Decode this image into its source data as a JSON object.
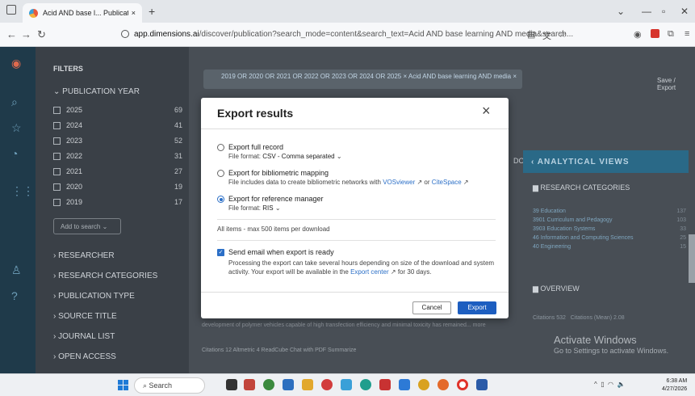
{
  "browser": {
    "tab_title": "Acid AND base l... Publication Y",
    "tab_close": "×",
    "new_tab": "+",
    "url_domain": "app.dimensions.ai",
    "url_path": "/discover/publication?search_mode=content&search_text=Acid AND base learning AND media&search..."
  },
  "filters": {
    "heading": "FILTERS",
    "pub_year_label": "PUBLICATION YEAR",
    "years": [
      {
        "year": "2025",
        "count": "69"
      },
      {
        "year": "2024",
        "count": "41"
      },
      {
        "year": "2023",
        "count": "52"
      },
      {
        "year": "2022",
        "count": "31"
      },
      {
        "year": "2021",
        "count": "27"
      },
      {
        "year": "2020",
        "count": "19"
      },
      {
        "year": "2019",
        "count": "17"
      }
    ],
    "add_to_search": "Add to search",
    "sections": [
      "RESEARCHER",
      "RESEARCH CATEGORIES",
      "PUBLICATION TYPE",
      "SOURCE TITLE",
      "JOURNAL LIST",
      "OPEN ACCESS"
    ]
  },
  "main": {
    "chips": "2019 OR 2020 OR 2021 OR 2022 OR 2023 OR 2024 OR 2025 ×   Acid AND base learning AND media ×",
    "save_export": "Save / Export",
    "documents": "DOCUMENTS",
    "analytical_views": "ANALYTICAL VIEWS",
    "research_categories": "RESEARCH CATEGORIES",
    "categories": [
      {
        "name": "39 Education",
        "count": "137"
      },
      {
        "name": "3901 Curriculum and Pedagogy",
        "count": "103"
      },
      {
        "name": "3903 Education Systems",
        "count": "33"
      },
      {
        "name": "46 Information and Computing Sciences",
        "count": "25"
      },
      {
        "name": "40 Engineering",
        "count": "15"
      }
    ],
    "overview": "OVERVIEW",
    "citations": "Citations",
    "citations_value": "532",
    "citations_mean": "Citations (Mean)",
    "citations_mean_value": "2.08",
    "abstract": "development of polymer vehicles capable of high transfection efficiency and minimal toxicity has remained... more",
    "pub_actions": "Citations 12   Altmetric 4   ReadCube   Chat with PDF   Summarize",
    "activate_title": "Activate Windows",
    "activate_sub": "Go to Settings to activate Windows."
  },
  "modal": {
    "title": "Export results",
    "close": "×",
    "options": [
      {
        "title": "Export full record",
        "sub_prefix": "File format:",
        "sub_value": "CSV - Comma separated",
        "selected": false
      },
      {
        "title": "Export for bibliometric mapping",
        "sub_prefix": "File includes data to create bibliometric networks with",
        "link1": "VOSviewer",
        "mid": "or",
        "link2": "CiteSpace",
        "selected": false
      },
      {
        "title": "Export for reference manager",
        "sub_prefix": "File format:",
        "sub_value": "RIS",
        "selected": true
      }
    ],
    "all_items": "All items - max 500 items per download",
    "email_title": "Send email when export is ready",
    "email_desc_prefix": "Processing the export can take several hours depending on size of the download and system activity. Your export will be available in the",
    "email_link": "Export center",
    "email_desc_suffix": "for 30 days.",
    "cancel": "Cancel",
    "export": "Export"
  },
  "taskbar": {
    "search": "Search",
    "time": "6:38 AM",
    "date": "4/27/2026"
  }
}
